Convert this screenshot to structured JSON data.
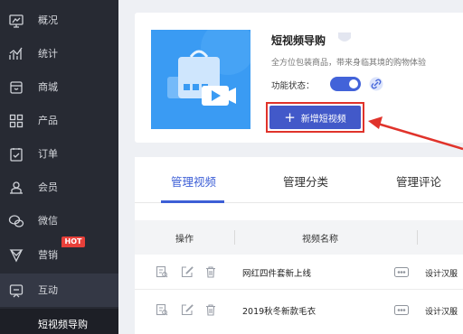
{
  "sidebar": {
    "items": [
      {
        "label": "概况",
        "icon": "overview-icon"
      },
      {
        "label": "统计",
        "icon": "stats-icon"
      },
      {
        "label": "商城",
        "icon": "store-icon"
      },
      {
        "label": "产品",
        "icon": "product-icon"
      },
      {
        "label": "订单",
        "icon": "order-icon"
      },
      {
        "label": "会员",
        "icon": "member-icon"
      },
      {
        "label": "微信",
        "icon": "wechat-icon"
      },
      {
        "label": "营销",
        "icon": "marketing-icon",
        "badge": "HOT"
      },
      {
        "label": "互动",
        "icon": "interaction-icon",
        "active": true
      }
    ],
    "sub_item": "短视频导购"
  },
  "product": {
    "title": "短视频导购",
    "description": "全方位包装商品，带来身临其境的购物体验",
    "status_label": "功能状态：",
    "status_on": true,
    "add_button": "新增短视频"
  },
  "tabs": [
    {
      "label": "管理视频",
      "active": true
    },
    {
      "label": "管理分类",
      "active": false
    },
    {
      "label": "管理评论",
      "active": false
    }
  ],
  "table": {
    "columns": [
      "操作",
      "视频名称"
    ],
    "rows": [
      {
        "name": "网红四件套新上线",
        "status": "设计汉服"
      },
      {
        "name": "2019秋冬新款毛衣",
        "status": "设计汉服"
      }
    ]
  },
  "colors": {
    "sidebar_bg": "#272a33",
    "accent": "#4259c9",
    "highlight": "#e0332b",
    "hot_badge": "#e8403a"
  }
}
